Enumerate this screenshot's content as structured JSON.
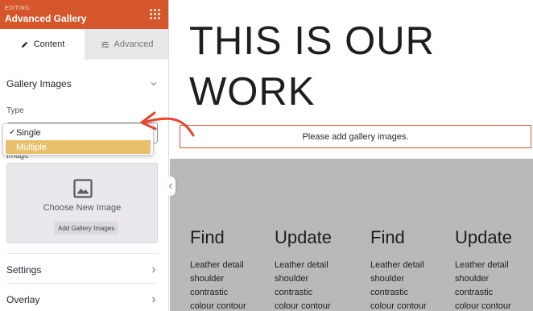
{
  "sidebar": {
    "header": {
      "editing": "EDITING:",
      "title": "Advanced Gallery"
    },
    "tabs": [
      {
        "label": "Content"
      },
      {
        "label": "Advanced"
      }
    ],
    "gallery_section": {
      "title": "Gallery Images"
    },
    "type": {
      "label": "Type",
      "options": [
        {
          "label": "Single",
          "selected": true
        },
        {
          "label": "Multiple",
          "highlighted": true
        }
      ]
    },
    "image": {
      "label": "Image",
      "choose_text": "Choose New Image",
      "add_button": "Add Gallery Images"
    },
    "sections": [
      {
        "title": "Settings"
      },
      {
        "title": "Overlay"
      }
    ]
  },
  "preview": {
    "heading_line1": "THIS IS OUR",
    "heading_line2": "WORK",
    "notice": "Please add gallery images.",
    "columns": [
      {
        "title": "Find",
        "lines": [
          "Leather detail",
          "shoulder",
          "contrastic",
          "colour contour"
        ]
      },
      {
        "title": "Update",
        "lines": [
          "Leather detail",
          "shoulder",
          "contrastic",
          "colour contour"
        ]
      },
      {
        "title": "Find",
        "lines": [
          "Leather detail",
          "shoulder",
          "contrastic",
          "colour contour"
        ]
      },
      {
        "title": "Update",
        "lines": [
          "Leather detail",
          "shoulder",
          "contrastic",
          "colour contour"
        ]
      }
    ]
  },
  "colors": {
    "accent": "#d4562a",
    "highlight": "#e8c06c",
    "arrow": "#e8452c",
    "gray_band": "#b9b9b9"
  },
  "icons": [
    "grid-drag-icon",
    "pencil-icon",
    "sliders-icon",
    "chevron-down-icon",
    "image-placeholder-icon",
    "chevron-right-icon",
    "chevron-left-icon",
    "annotation-arrow"
  ]
}
